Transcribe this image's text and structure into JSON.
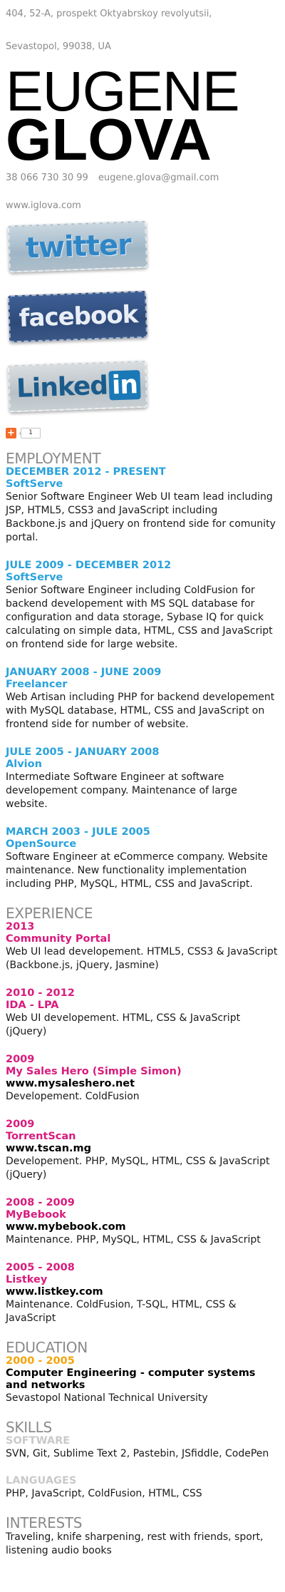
{
  "header": {
    "address_line1": "404, 52-A, prospekt Oktyabrskoy revolyutsii,",
    "address_line2": "Sevastopol, 99038, UA",
    "first_name": "EUGENE",
    "last_name": "GLOVA",
    "phone": "38 066 730 30 99",
    "email": "eugene.glova@gmail.com",
    "website": "www.iglova.com"
  },
  "social": {
    "twitter_label": "twitter",
    "facebook_label": "facebook",
    "linkedin_label": "Linked",
    "linkedin_in": "in",
    "share_count": "1"
  },
  "colors": {
    "employment_accent": "#2aa2dc",
    "experience_accent": "#d81b7d",
    "education_accent": "#f5a30c",
    "skills_subheading": "#c9c9c9"
  },
  "employment": {
    "title": "EMPLOYMENT",
    "items": [
      {
        "date": "DECEMBER 2012 - PRESENT",
        "org": "SoftServe",
        "desc": "Senior Software Engineer Web UI team lead including JSP, HTML5, CSS3 and JavaScript including Backbone.js and jQuery on frontend side for comunity portal."
      },
      {
        "date": "JULE 2009 - DECEMBER 2012",
        "org": "SoftServe",
        "desc": "Senior Software Engineer including ColdFusion for backend developement with MS SQL database for configuration and data storage, Sybase IQ for quick calculating on simple data, HTML, CSS and JavaScript on frontend side for large website."
      },
      {
        "date": "JANUARY 2008 - JUNE 2009",
        "org": "Freelancer",
        "desc": "Web Artisan including PHP for backend developement with MySQL database, HTML, CSS and JavaScript on frontend side for number of website."
      },
      {
        "date": "JULE 2005 - JANUARY 2008",
        "org": "Alvion",
        "desc": "Intermediate Software Engineer at software developement company. Maintenance of large website."
      },
      {
        "date": "MARCH 2003 - JULE 2005",
        "org": "OpenSource",
        "desc": "Software Engineer at eCommerce company. Website maintenance. New functionality implementation including PHP, MySQL, HTML, CSS and JavaScript."
      }
    ]
  },
  "experience": {
    "title": "EXPERIENCE",
    "items": [
      {
        "date": "2013",
        "org": "Community Portal",
        "site": "",
        "desc": "Web UI lead developement. HTML5, CSS3 & JavaScript (Backbone.js, jQuery, Jasmine)"
      },
      {
        "date": "2010 - 2012",
        "org": "IDA - LPA",
        "site": "",
        "desc": "Web UI developement. HTML, CSS & JavaScript (jQuery)"
      },
      {
        "date": "2009",
        "org": "My Sales Hero (Simple Simon)",
        "site": "www.mysaleshero.net",
        "desc": "Developement. ColdFusion"
      },
      {
        "date": "2009",
        "org": "TorrentScan",
        "site": "www.tscan.mg",
        "desc": "Developement. PHP, MySQL, HTML, CSS & JavaScript (jQuery)"
      },
      {
        "date": "2008 - 2009",
        "org": "MyBebook",
        "site": "www.mybebook.com",
        "desc": "Maintenance. PHP, MySQL, HTML, CSS & JavaScript"
      },
      {
        "date": "2005 - 2008",
        "org": "Listkey",
        "site": "www.listkey.com",
        "desc": "Maintenance. ColdFusion, T-SQL, HTML, CSS & JavaScript"
      }
    ]
  },
  "education": {
    "title": "EDUCATION",
    "date": "2000 - 2005",
    "degree": "Computer Engineering - computer systems and networks",
    "school": "Sevastopol National Technical University"
  },
  "skills": {
    "title": "SKILLS",
    "software_label": "SOFTWARE",
    "software": "SVN, Git, Sublime Text 2, Pastebin, JSfiddle, CodePen",
    "languages_label": "LANGUAGES",
    "languages": "PHP, JavaScript, ColdFusion, HTML, CSS"
  },
  "interests": {
    "title": "INTERESTS",
    "text": "Traveling, knife sharpening, rest with friends, sport, listening audio books"
  }
}
